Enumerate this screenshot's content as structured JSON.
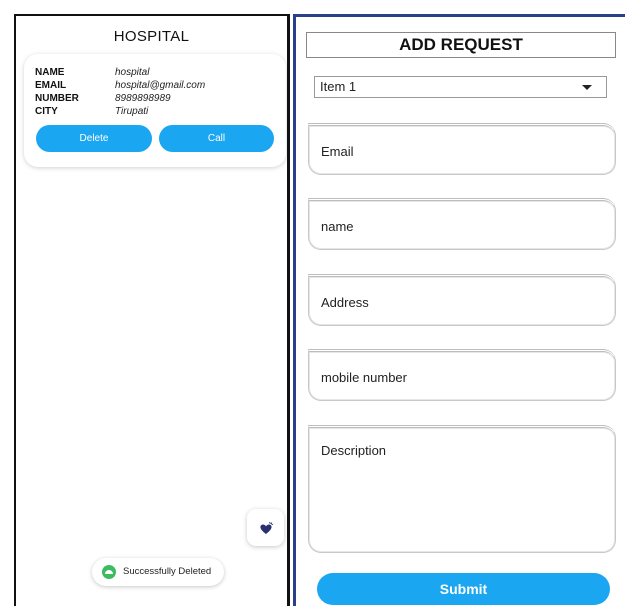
{
  "left_screen": {
    "title": "HOSPITAL",
    "card": {
      "fields": [
        {
          "key": "NAME",
          "value": "hospital"
        },
        {
          "key": "EMAIL",
          "value": "hospital@gmail.com"
        },
        {
          "key": "NUMBER",
          "value": "8989898989"
        },
        {
          "key": "CITY",
          "value": "Tirupati"
        }
      ],
      "delete_label": "Delete",
      "call_label": "Call"
    },
    "fab_icon": "heart-hand-icon",
    "toast": {
      "icon": "android-icon",
      "text": "Successfully Deleted"
    }
  },
  "right_screen": {
    "title": "ADD REQUEST",
    "dropdown": {
      "selected": "Item 1"
    },
    "fields": {
      "email": "Email",
      "name": "name",
      "address": "Address",
      "mobile": "mobile number",
      "description": "Description"
    },
    "submit_label": "Submit"
  },
  "colors": {
    "accent": "#1aa6f0",
    "toast_icon": "#3dbb61",
    "frame": "#2c3f8a"
  }
}
